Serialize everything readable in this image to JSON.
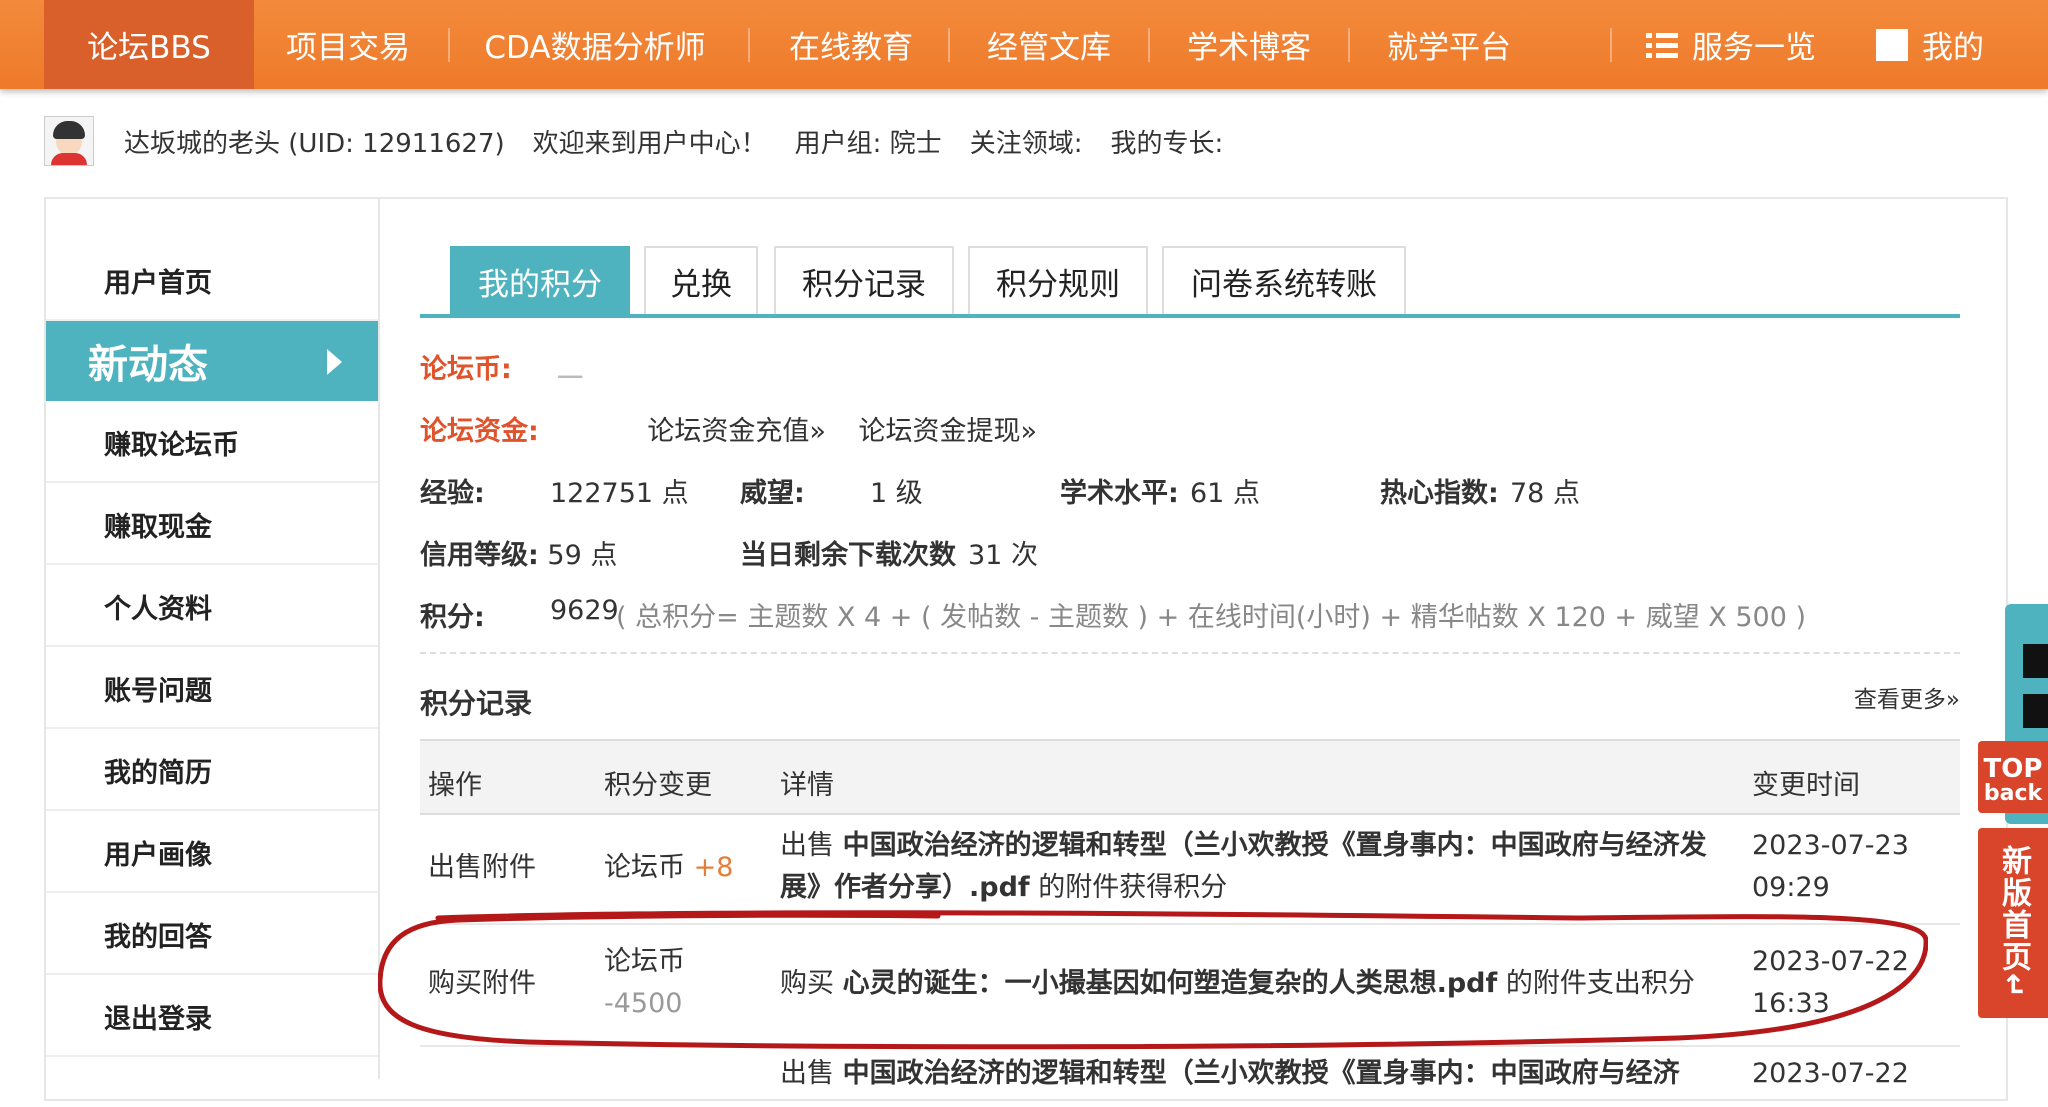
{
  "topnav": {
    "items": [
      "论坛BBS",
      "项目交易",
      "CDA数据分析师",
      "在线教育",
      "经管文库",
      "学术博客",
      "就学平台"
    ],
    "services": "服务一览",
    "mine": "我的"
  },
  "userbar": {
    "name": "达坂城的老头 (UID: 12911627)",
    "welcome": "欢迎来到用户中心！",
    "group": "用户组: 院士",
    "focus": "关注领域:",
    "expertise": "我的专长:"
  },
  "sidebar": {
    "items": [
      "用户首页",
      "新动态",
      "赚取论坛币",
      "赚取现金",
      "个人资料",
      "账号问题",
      "我的简历",
      "用户画像",
      "我的回答",
      "退出登录"
    ]
  },
  "tabs": [
    "我的积分",
    "兑换",
    "积分记录",
    "积分规则",
    "问卷系统转账"
  ],
  "points": {
    "coin_label": "论坛币:",
    "coin_value": "ـــ",
    "fund_label": "论坛资金:",
    "fund_recharge": "论坛资金充值»",
    "fund_withdraw": "论坛资金提现»",
    "exp_label": "经验:",
    "exp_value": "122751 点",
    "prestige_label": "威望:",
    "prestige_value": "1 级",
    "academic_label": "学术水平:",
    "academic_value": "61 点",
    "enthusiasm_label": "热心指数:",
    "enthusiasm_value": "78 点",
    "credit_label": "信用等级:",
    "credit_value": "59 点",
    "downloads_label": "当日剩余下载次数",
    "downloads_value": "31 次",
    "score_label": "积分:",
    "score_value": "9629",
    "score_formula": "( 总积分= 主题数 X 4 + ( 发帖数 - 主题数 ) + 在线时间(小时) + 精华帖数 X 120 + 威望 X 500 )"
  },
  "records": {
    "title": "积分记录",
    "more": "查看更多»",
    "headers": [
      "操作",
      "积分变更",
      "详情",
      "变更时间"
    ],
    "rows": [
      {
        "op": "出售附件",
        "change_unit": "论坛币",
        "change_val": "+8",
        "detail_pre": "出售",
        "detail_title": "中国政治经济的逻辑和转型（兰小欢教授《置身事内：中国政府与经济发展》作者分享）.pdf",
        "detail_post": "的附件获得积分",
        "date": "2023-07-23",
        "time": "09:29"
      },
      {
        "op": "购买附件",
        "change_unit": "论坛币",
        "change_val": "-4500",
        "detail_pre": "购买",
        "detail_title": "心灵的诞生：一小撮基因如何塑造复杂的人类思想.pdf",
        "detail_post": "的附件支出积分",
        "date": "2023-07-22",
        "time": "16:33"
      },
      {
        "op": "",
        "detail_pre": "出售",
        "detail_title": "中国政治经济的逻辑和转型（兰小欢教授《置身事内：中国政府与经济",
        "date": "2023-07-22"
      }
    ]
  },
  "widgets": {
    "top_text": "TOP",
    "back_text": "back",
    "newhome": "新版首页↵"
  }
}
